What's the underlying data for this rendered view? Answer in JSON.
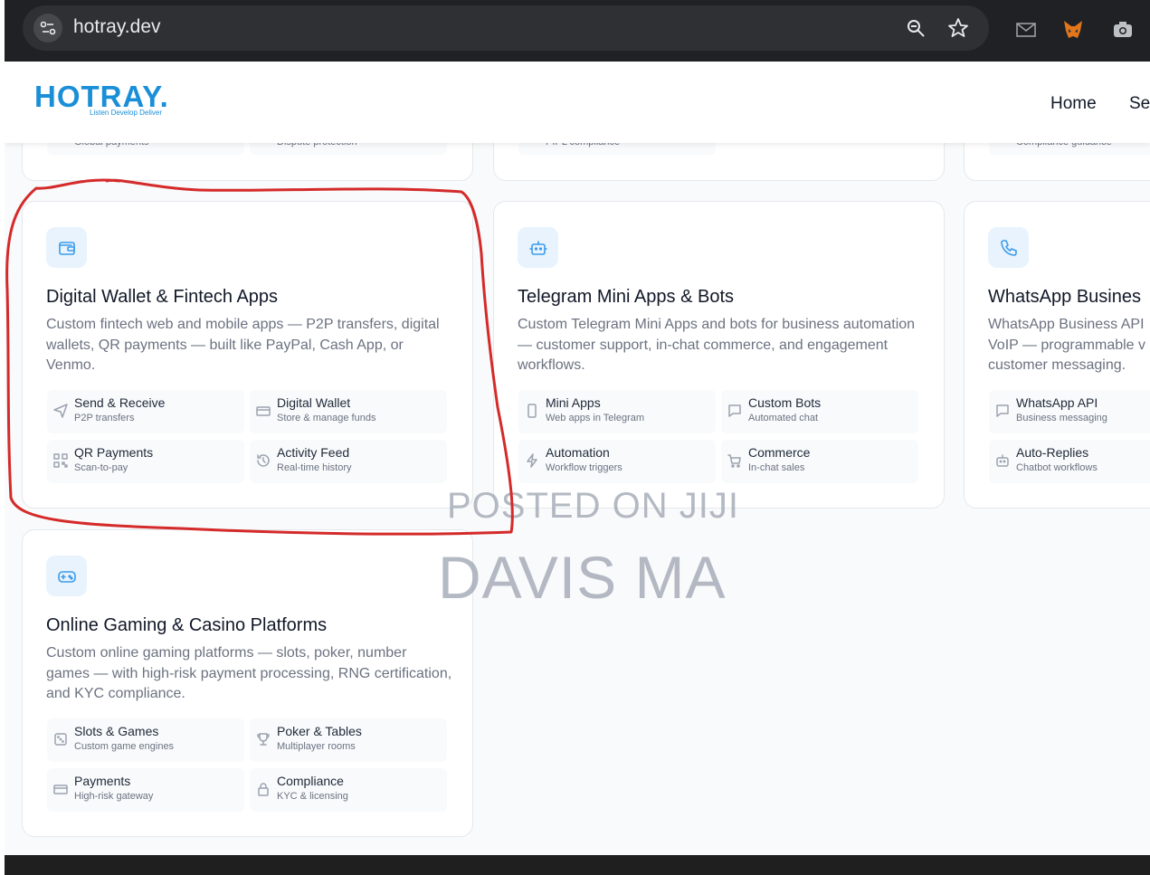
{
  "browser": {
    "url": "hotray.dev"
  },
  "header": {
    "logo": "HOTRAY.",
    "tagline": "Listen Develop Deliver",
    "nav": [
      "Home",
      "Se"
    ]
  },
  "top_cards_partial": [
    "Global payments",
    "Dispute protection",
    "PIPL compliance",
    "Compliance guidance"
  ],
  "cards": [
    {
      "title": "Digital Wallet & Fintech Apps",
      "icon": "wallet-icon",
      "description": "Custom fintech web and mobile apps — P2P transfers, digital wallets, QR payments — built like PayPal, Cash App, or Venmo.",
      "features": [
        {
          "name": "Send & Receive",
          "sub": "P2P transfers",
          "icon": "send-icon"
        },
        {
          "name": "Digital Wallet",
          "sub": "Store & manage funds",
          "icon": "card-icon"
        },
        {
          "name": "QR Payments",
          "sub": "Scan-to-pay",
          "icon": "qr-icon"
        },
        {
          "name": "Activity Feed",
          "sub": "Real-time history",
          "icon": "history-icon"
        }
      ]
    },
    {
      "title": "Telegram Mini Apps & Bots",
      "icon": "bot-icon",
      "description": "Custom Telegram Mini Apps and bots for business automation — customer support, in-chat commerce, and engagement workflows.",
      "features": [
        {
          "name": "Mini Apps",
          "sub": "Web apps in Telegram",
          "icon": "phone-icon"
        },
        {
          "name": "Custom Bots",
          "sub": "Automated chat",
          "icon": "chat-icon"
        },
        {
          "name": "Automation",
          "sub": "Workflow triggers",
          "icon": "bolt-icon"
        },
        {
          "name": "Commerce",
          "sub": "In-chat sales",
          "icon": "cart-icon"
        }
      ]
    },
    {
      "title": "WhatsApp Busines",
      "icon": "phone-call-icon",
      "description": "WhatsApp Business API VoIP — programmable v customer messaging.",
      "features": [
        {
          "name": "WhatsApp API",
          "sub": "Business messaging",
          "icon": "chat-icon"
        },
        {
          "name": "Auto-Replies",
          "sub": "Chatbot workflows",
          "icon": "bot-icon"
        }
      ]
    },
    {
      "title": "Online Gaming & Casino Platforms",
      "icon": "gamepad-icon",
      "description": "Custom online gaming platforms — slots, poker, number games — with high-risk payment processing, RNG certification, and KYC compliance.",
      "features": [
        {
          "name": "Slots & Games",
          "sub": "Custom game engines",
          "icon": "dice-icon"
        },
        {
          "name": "Poker & Tables",
          "sub": "Multiplayer rooms",
          "icon": "trophy-icon"
        },
        {
          "name": "Payments",
          "sub": "High-risk gateway",
          "icon": "card-icon"
        },
        {
          "name": "Compliance",
          "sub": "KYC & licensing",
          "icon": "lock-icon"
        }
      ]
    }
  ],
  "watermark": {
    "line1": "POSTED ON JIJI",
    "line2": "DAVIS MA"
  },
  "annotation_color": "#d42a2a",
  "accent_color": "#3b9bea"
}
